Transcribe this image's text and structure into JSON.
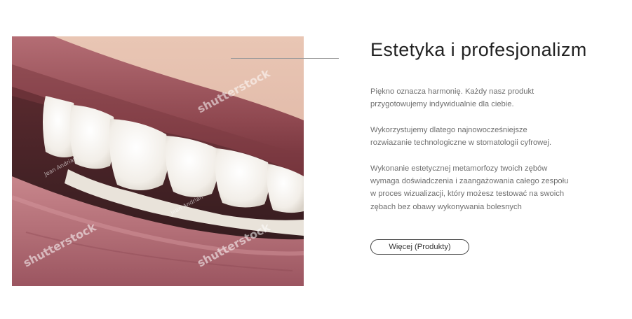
{
  "section": {
    "title": "Estetyka i profesjonalizm",
    "paragraphs": [
      [
        "Piękno oznacza harmonię. Każdy nasz produkt",
        "przygotowujemy indywidualnie dla ciebie."
      ],
      [
        "Wykorzystujemy dlatego najnowocześniejsze",
        "rozwiazanie technologiczne w stomatologii cyfrowej."
      ],
      [
        "Wykonanie estetycznej metamorfozy twoich zębów",
        "wymaga doświadczenia i zaangażowania całego zespołu",
        "w proces wizualizacji, który możesz testować na swoich",
        "zębach bez obawy wykonywania bolesnych"
      ]
    ],
    "button_label": "Więcej (Produkty)"
  },
  "photo": {
    "watermark_brand": "shutterstock",
    "watermark_author": "Jean Andrian"
  },
  "colors": {
    "title": "#222222",
    "body_text": "#6f6f6f",
    "button_border": "#444444",
    "divider": "#9a9a9a",
    "lip": "#a8646b",
    "teeth": "#f4f1ec"
  }
}
